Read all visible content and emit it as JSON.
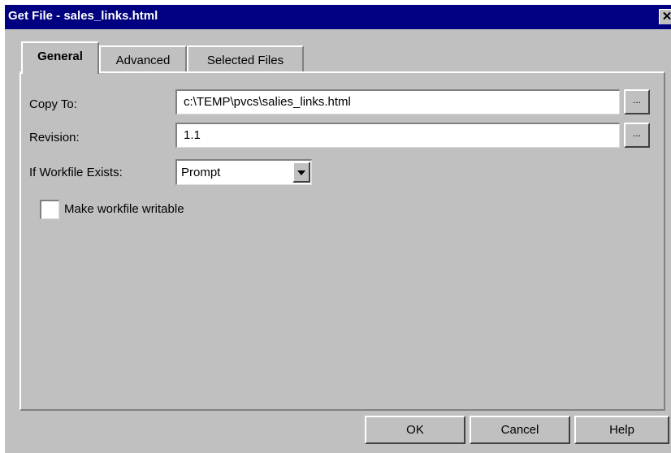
{
  "window": {
    "title": "Get File - sales_links.html",
    "close_glyph": "✕"
  },
  "tabs": [
    {
      "label": "General",
      "active": true
    },
    {
      "label": "Advanced",
      "active": false
    },
    {
      "label": "Selected Files",
      "active": false
    }
  ],
  "form": {
    "copy_to_label": "Copy To:",
    "copy_to_value": "c:\\TEMP\\pvcs\\salies_links.html",
    "revision_label": "Revision:",
    "revision_value": "1.1",
    "browse_label": "...",
    "if_exists_label": "If Workfile Exists:",
    "if_exists_value": "Prompt",
    "writable_label": "Make workfile writable",
    "writable_checked": false
  },
  "buttons": {
    "ok": "OK",
    "cancel": "Cancel",
    "help": "Help"
  },
  "colors": {
    "titlebar": "#000080",
    "face": "#c0c0c0"
  }
}
